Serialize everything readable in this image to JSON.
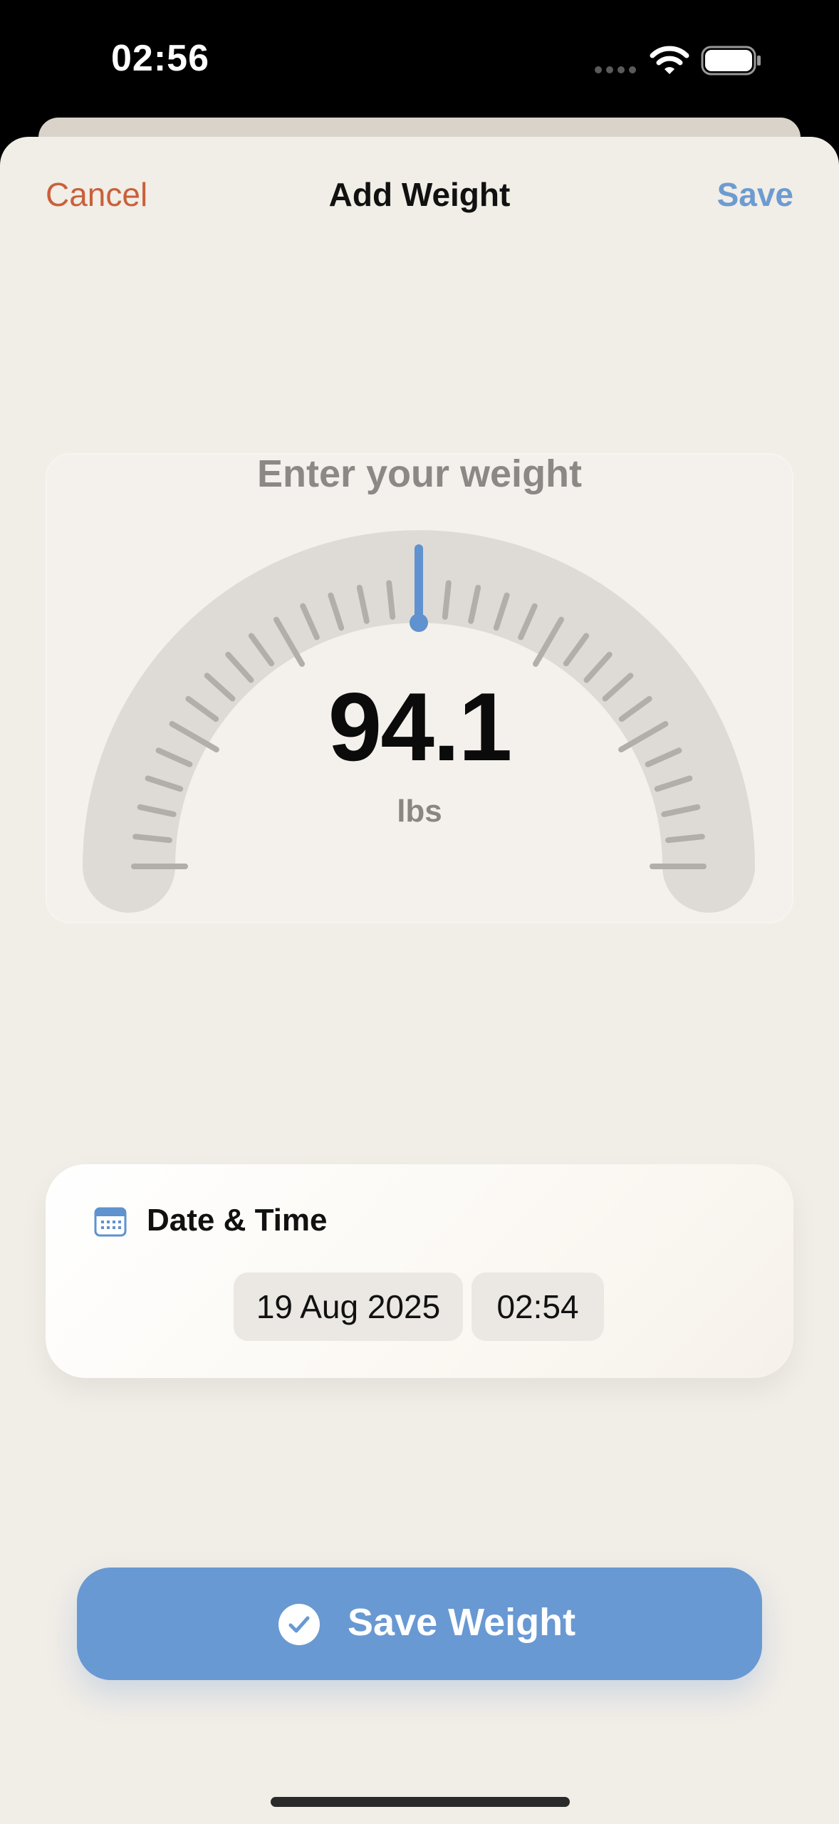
{
  "status_bar": {
    "time": "02:56"
  },
  "nav": {
    "cancel_label": "Cancel",
    "title": "Add Weight",
    "save_label": "Save"
  },
  "gauge": {
    "prompt": "Enter your weight",
    "value": "94.1",
    "unit": "lbs",
    "needle_fraction": 0.5
  },
  "date_time": {
    "label": "Date & Time",
    "date": "19 Aug 2025",
    "time": "02:54"
  },
  "save_button": {
    "label": "Save Weight"
  },
  "icons": {
    "status": [
      "cellular-dots-icon",
      "wifi-icon",
      "battery-icon"
    ],
    "date_time": "calendar-icon",
    "save_button": "checkmark-circle-icon"
  },
  "colors": {
    "accent_blue": "#6899d2",
    "cancel_orange": "#c9603a",
    "sheet_bg": "#f1ede7",
    "gauge_track": "#dedad5",
    "gauge_tick": "#b2aeaa",
    "needle": "#5f92cf"
  }
}
